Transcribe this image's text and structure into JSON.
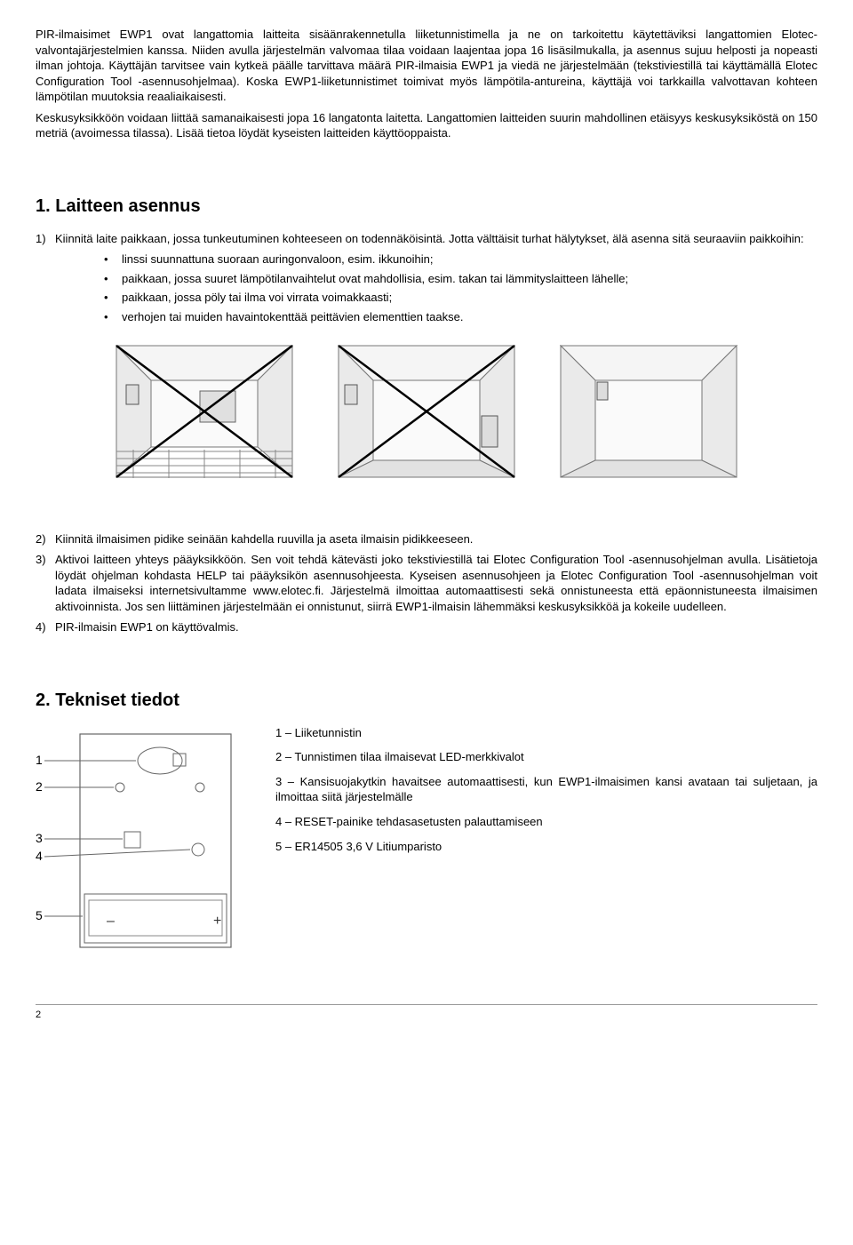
{
  "intro": {
    "p1": "PIR-ilmaisimet EWP1 ovat langattomia laitteita sisäänrakennetulla liiketunnistimella ja ne on tarkoitettu käytettäviksi langattomien Elotec-valvontajärjestelmien kanssa. Niiden avulla järjestelmän valvomaa tilaa voidaan laajentaa jopa 16 lisäsilmukalla, ja asennus sujuu helposti ja nopeasti ilman johtoja. Käyttäjän tarvitsee vain kytkeä päälle tarvittava määrä PIR-ilmaisia EWP1 ja viedä ne järjestelmään (tekstiviestillä tai käyttämällä Elotec Configuration Tool -asennusohjelmaa). Koska EWP1-liiketunnistimet toimivat myös lämpötila-antureina, käyttäjä voi tarkkailla valvottavan kohteen lämpötilan muutoksia reaaliaikaisesti.",
    "p2": "Keskusyksikköön voidaan liittää samanaikaisesti jopa 16 langatonta laitetta. Langattomien laitteiden suurin mahdollinen etäisyys keskusyksiköstä on 150 metriä (avoimessa tilassa). Lisää tietoa löydät kyseisten laitteiden käyttöoppaista."
  },
  "section1": {
    "title": "1. Laitteen asennus",
    "item1": "Kiinnitä laite paikkaan, jossa tunkeutuminen kohteeseen on todennäköisintä. Jotta välttäisit turhat hälytykset, älä asenna sitä seuraaviin paikkoihin:",
    "sub1": "linssi suunnattuna suoraan auringonvaloon, esim. ikkunoihin;",
    "sub2": "paikkaan, jossa suuret lämpötilanvaihtelut ovat mahdollisia, esim. takan tai lämmityslaitteen lähelle;",
    "sub3": "paikkaan, jossa pöly tai ilma voi virrata voimakkaasti;",
    "sub4": "verhojen tai muiden havaintokenttää peittävien elementtien taakse.",
    "item2": "Kiinnitä ilmaisimen pidike seinään kahdella ruuvilla ja aseta ilmaisin pidikkeeseen.",
    "item3": "Aktivoi laitteen yhteys pääyksikköön. Sen voit tehdä kätevästi joko tekstiviestillä tai Elotec Configuration Tool -asennusohjelman avulla. Lisätietoja löydät ohjelman kohdasta HELP tai pääyksikön asennusohjeesta. Kyseisen asennusohjeen ja Elotec Configuration Tool -asennusohjelman voit ladata ilmaiseksi internetsivultamme www.elotec.fi. Järjestelmä ilmoittaa automaattisesti sekä onnistuneesta että epäonnistuneesta ilmaisimen aktivoinnista. Jos sen liittäminen järjestelmään ei onnistunut, siirrä EWP1-ilmaisin lähemmäksi keskusyksikköä ja kokeile uudelleen.",
    "item4": "PIR-ilmaisin EWP1 on käyttövalmis."
  },
  "section2": {
    "title": "2. Tekniset tiedot",
    "l1": "1 – Liiketunnistin",
    "l2": "2 – Tunnistimen tilaa ilmaisevat LED-merkkivalot",
    "l3": "3 – Kansisuojakytkin havaitsee automaattisesti, kun EWP1-ilmaisimen kansi avataan tai suljetaan, ja ilmoittaa siitä järjestelmälle",
    "l4": "4 – RESET-painike tehdasasetusten palauttamiseen",
    "l5": "5 – ER14505 3,6 V Litiumparisto"
  },
  "diagram_labels": {
    "n1": "1",
    "n2": "2",
    "n3": "3",
    "n4": "4",
    "n5": "5",
    "minus": "–",
    "plus": "+"
  },
  "page_number": "2"
}
